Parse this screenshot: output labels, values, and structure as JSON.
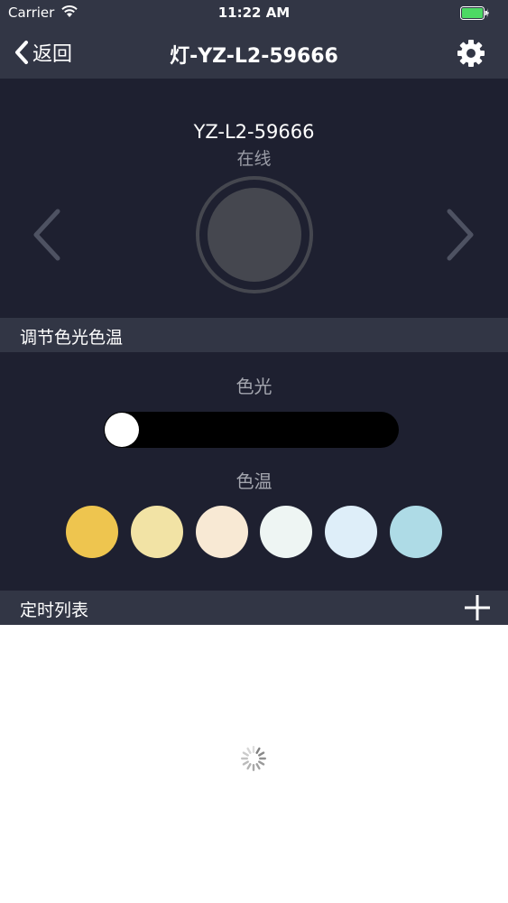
{
  "status_bar": {
    "carrier": "Carrier",
    "time": "11:22 AM",
    "battery_color": "#4cd964"
  },
  "nav": {
    "back_label": "返回",
    "title": "灯-YZ-L2-59666"
  },
  "device": {
    "name": "YZ-L2-59666",
    "state": "在线"
  },
  "sections": {
    "adjust_title": "调节色光色温",
    "timer_title": "定时列表"
  },
  "adjust": {
    "light_label": "色光",
    "temp_label": "色温",
    "slider_value": 0,
    "swatches": [
      "#eec54f",
      "#f2e3a5",
      "#f8e9d4",
      "#eef5f3",
      "#deeef9",
      "#aedbe6"
    ]
  },
  "colors": {
    "header": "#323645",
    "panel": "#1e2030",
    "list_bg": "#ffffff"
  }
}
